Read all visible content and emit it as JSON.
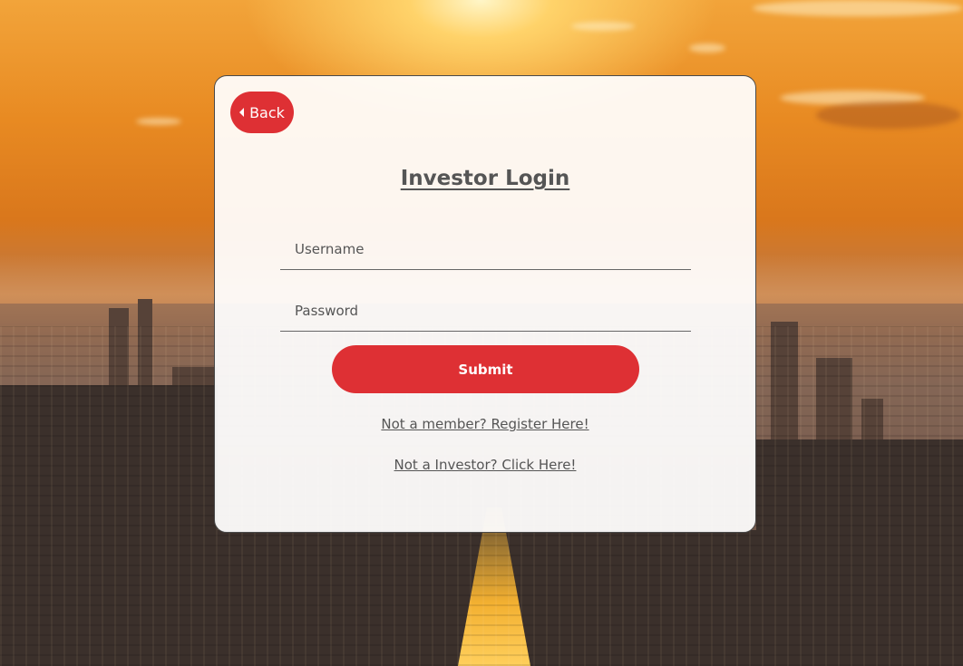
{
  "login": {
    "back_label": "Back",
    "title": "Investor Login",
    "username_placeholder": "Username",
    "password_placeholder": "Password",
    "submit_label": "Submit",
    "register_link": "Not a member? Register Here!",
    "not_investor_link": "Not a Investor? Click Here!"
  },
  "theme": {
    "accent": "#de3034",
    "text": "#555555",
    "card_background": "#ffffff"
  },
  "icons": {
    "back": "caret-left-icon"
  }
}
